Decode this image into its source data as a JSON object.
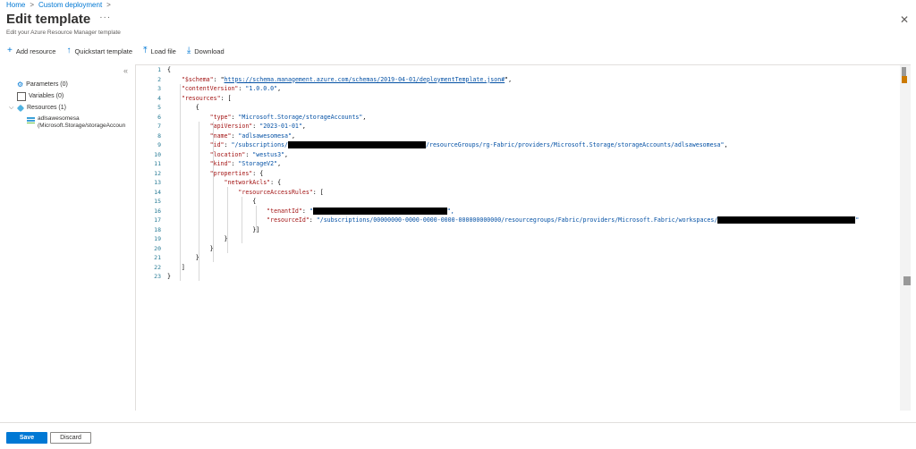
{
  "breadcrumb": {
    "items": [
      "Home",
      "Custom deployment"
    ]
  },
  "header": {
    "title": "Edit template",
    "more": "···",
    "subtitle": "Edit your Azure Resource Manager template"
  },
  "toolbar": {
    "add_resource": "Add resource",
    "quickstart": "Quickstart template",
    "load_file": "Load file",
    "download": "Download"
  },
  "tree": {
    "parameters": "Parameters (0)",
    "variables": "Variables (0)",
    "resources": "Resources (1)",
    "resource_name": "adlsawesomesa",
    "resource_type": "(Microsoft.Storage/storageAccoun"
  },
  "editor": {
    "line_numbers": [
      "1",
      "2",
      "3",
      "4",
      "5",
      "6",
      "7",
      "8",
      "9",
      "10",
      "11",
      "12",
      "13",
      "14",
      "15",
      "16",
      "17",
      "18",
      "19",
      "20",
      "21",
      "22",
      "23"
    ],
    "schema_key": "\"$schema\"",
    "schema_val": "https://schema.management.azure.com/schemas/2019-04-01/deploymentTemplate.json#",
    "cv_key": "\"contentVersion\"",
    "cv_val": "\"1.0.0.0\"",
    "res_key": "\"resources\"",
    "type_key": "\"type\"",
    "type_val": "\"Microsoft.Storage/storageAccounts\"",
    "api_key": "\"apiVersion\"",
    "api_val": "\"2023-01-01\"",
    "name_key": "\"name\"",
    "name_val": "\"adlsawesomesa\"",
    "id_key": "\"id\"",
    "id_pre": "\"/subscriptions/",
    "id_post": "/resourceGroups/rg-Fabric/providers/Microsoft.Storage/storageAccounts/adlsawesomesa\"",
    "loc_key": "\"location\"",
    "loc_val": "\"westus3\"",
    "kind_key": "\"kind\"",
    "kind_val": "\"StorageV2\"",
    "props_key": "\"properties\"",
    "acl_key": "\"networkAcls\"",
    "rar_key": "\"resourceAccessRules\"",
    "tenant_key": "\"tenantId\"",
    "tenant_pre": "\"",
    "tenant_post": "\",",
    "rid_key": "\"resourceId\"",
    "rid_pre": "\"/subscriptions/00000000-0000-0000-0000-000000000000/resourcegroups/Fabric/providers/Microsoft.Fabric/workspaces/",
    "rid_post": "\""
  },
  "footer": {
    "save": "Save",
    "discard": "Discard"
  }
}
